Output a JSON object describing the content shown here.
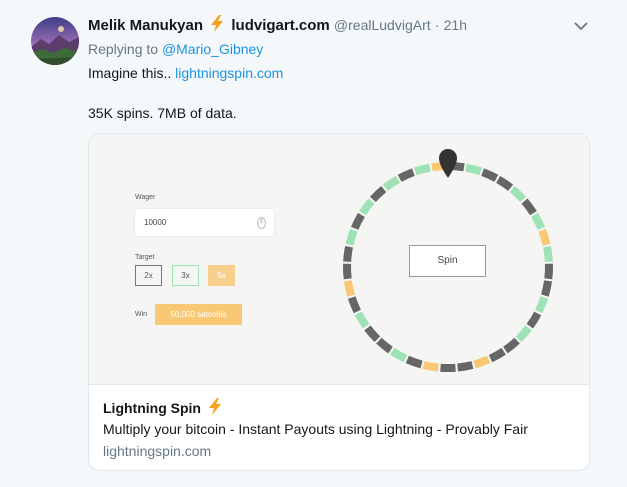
{
  "tweet": {
    "name": "Melik Manukyan",
    "name_emoji": "bolt-emoji",
    "name_suffix": "ludvigart.com",
    "handle": "@realLudvigArt",
    "separator": "·",
    "time": "21h",
    "replying_prefix": "Replying to",
    "replying_handle": "@Mario_Gibney",
    "text_line1_prefix": "Imagine this..",
    "text_line1_link": "lightningspin.com",
    "text_line2": "35K spins. 7MB of data."
  },
  "card": {
    "app": {
      "wager_label": "Wager",
      "wager_value": "10000",
      "target_label": "Target",
      "targets": [
        "2x",
        "3x",
        "5x"
      ],
      "selected_target": "5x",
      "win_label": "Win",
      "win_amount": "50,000 satoshis",
      "spin_label": "Spin",
      "wheel_segments": [
        "gray",
        "green",
        "gray",
        "gray",
        "green",
        "gray",
        "green",
        "orange",
        "green",
        "gray",
        "gray",
        "green",
        "gray",
        "green",
        "gray",
        "gray",
        "orange",
        "gray",
        "gray",
        "orange",
        "gray",
        "green",
        "gray",
        "gray",
        "green",
        "gray",
        "orange",
        "gray",
        "gray",
        "green",
        "gray",
        "green",
        "gray",
        "green",
        "gray",
        "green",
        "orange"
      ]
    },
    "title": "Lightning Spin",
    "title_emoji": "bolt-emoji",
    "description": "Multiply your bitcoin - Instant Payouts using Lightning - Provably Fair",
    "url": "lightningspin.com"
  },
  "colors": {
    "link": "#1b95e0",
    "muted": "#657786",
    "wheel_green": "#9ee2b6",
    "wheel_orange": "#f8c874",
    "wheel_gray": "#666666"
  }
}
